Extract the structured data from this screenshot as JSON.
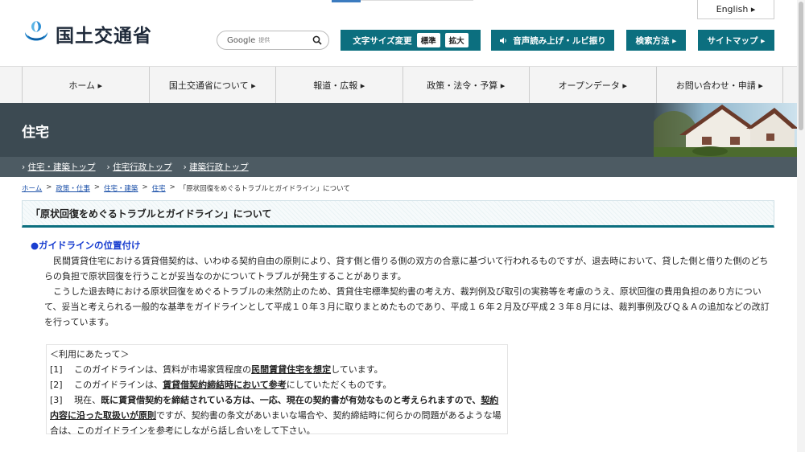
{
  "header": {
    "english_label": "English ▸",
    "logo_text": "国土交通省",
    "search": {
      "provider": "Google",
      "suffix": "提供"
    },
    "buttons": {
      "text_size": "文字サイズ変更",
      "standard": "標準",
      "large": "拡大",
      "voice": "音声読み上げ・ルビ振り",
      "search_method": "検索方法 ▸",
      "sitemap": "サイトマップ ▸"
    }
  },
  "nav": {
    "items": [
      {
        "label": "ホーム ▸"
      },
      {
        "label": "国土交通省について ▸"
      },
      {
        "label": "報道・広報 ▸"
      },
      {
        "label": "政策・法令・予算 ▸"
      },
      {
        "label": "オープンデータ ▸"
      },
      {
        "label": "お問い合わせ・申請 ▸"
      }
    ]
  },
  "banner": {
    "title": "住宅"
  },
  "subnav": {
    "items": [
      "住宅・建築トップ",
      "住宅行政トップ",
      "建築行政トップ"
    ]
  },
  "breadcrumb": {
    "links": [
      "ホーム",
      "政策・仕事",
      "住宅・建築",
      "住宅"
    ],
    "separator": ">",
    "current": "「原状回復をめぐるトラブルとガイドライン」について"
  },
  "main": {
    "heading": "「原状回復をめぐるトラブルとガイドライン」について",
    "section_title": "●ガイドラインの位置付け",
    "paragraph1": "　民間賃貸住宅における賃貸借契約は、いわゆる契約自由の原則により、貸す側と借りる側の双方の合意に基づいて行われるものですが、退去時において、貸した側と借りた側のどちらの負担で原状回復を行うことが妥当なのかについてトラブルが発生することがあります。",
    "paragraph2": "　こうした退去時における原状回復をめぐるトラブルの未然防止のため、賃貸住宅標準契約書の考え方、裁判例及び取引の実務等を考慮のうえ、原状回復の費用負担のあり方について、妥当と考えられる一般的な基準をガイドラインとして平成１０年３月に取りまとめたものであり、平成１６年２月及び平成２３年８月には、裁判事例及びＱ＆Ａの追加などの改訂を行っています。",
    "notes_title": "＜利用にあたって＞",
    "note1": {
      "prefix": "[1]　 このガイドラインは、賃料が市場家賃程度の",
      "emph": "民間賃貸住宅を想定",
      "suffix": "しています。"
    },
    "note2": {
      "prefix": "[2]　 このガイドラインは、",
      "emph": "賃貸借契約締結時において参考",
      "suffix": "にしていただくものです。"
    },
    "note3": {
      "prefix": "[3]　 現在、",
      "bold1": "既に賃貸借契約を締結されている方は、一応、現在の契約書が有効なものと考えられますので、",
      "emph": "契約内容に沿った取扱いが原則",
      "suffix": "ですが、契約書の条文があいまいな場合や、契約締結時に何らかの問題があるような場合は、このガイドラインを参考にしながら話し合いをして下さい。"
    }
  }
}
